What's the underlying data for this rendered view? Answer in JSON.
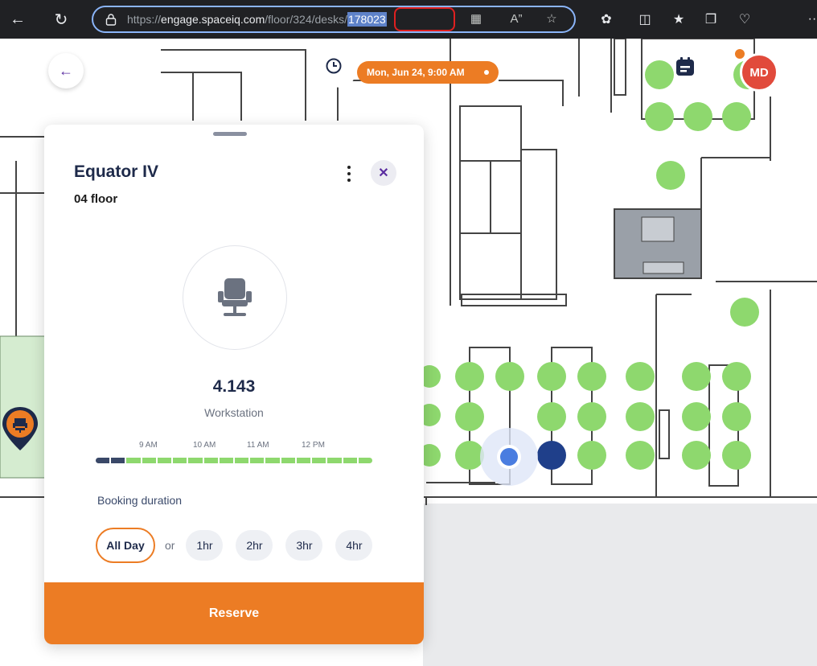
{
  "browser": {
    "url_scheme": "https://",
    "url_host": "engage.spaceiq.com",
    "url_path": "/floor/324/desks/",
    "url_selected": "178023"
  },
  "map": {
    "date_pill": "Mon, Jun 24, 9:00 AM",
    "avatar_initials": "MD"
  },
  "panel": {
    "title": "Equator IV",
    "floor": "04 floor",
    "desk_name": "4.143",
    "desk_type": "Workstation",
    "time_labels": [
      "9 AM",
      "10 AM",
      "11 AM",
      "12 PM"
    ],
    "booking_duration_label": "Booking duration",
    "duration_options": [
      "All Day",
      "1hr",
      "2hr",
      "3hr",
      "4hr"
    ],
    "or_label": "or",
    "selected_duration": "All Day",
    "reserve_label": "Reserve"
  },
  "colors": {
    "accent": "#ec7c24",
    "available": "#8ed86e",
    "selected": "#4a7de0",
    "title": "#1e2a4a"
  }
}
